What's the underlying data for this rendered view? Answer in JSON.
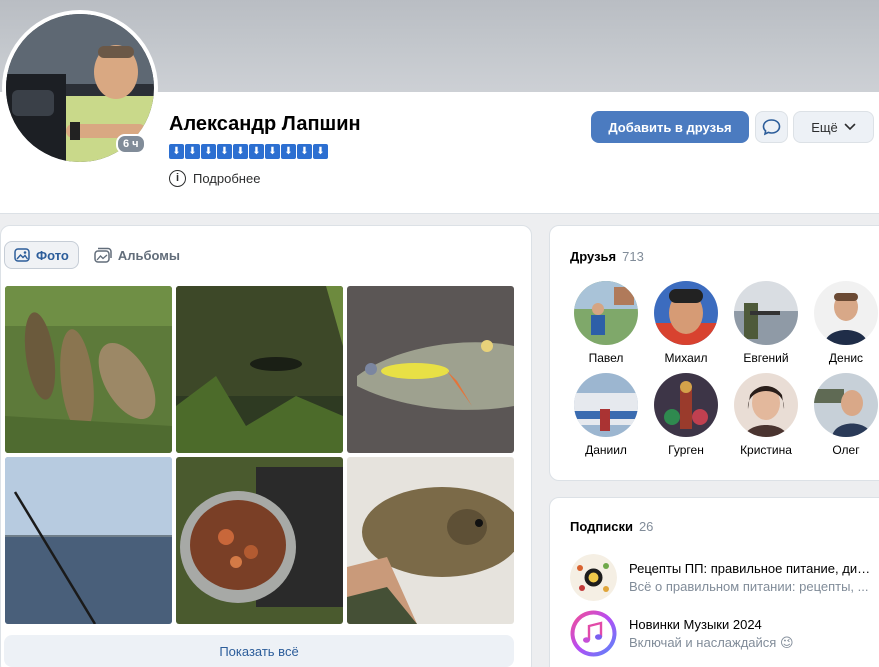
{
  "profile": {
    "name": "Александр Лапшин",
    "online_badge": "6 ч",
    "status_glyph": "⬇",
    "status_count": 10,
    "details_label": "Подробнее",
    "info_glyph": "i",
    "icons": {
      "info": "info-circle-icon",
      "message": "message-bubble-icon",
      "more": "chevron-down-icon"
    }
  },
  "actions": {
    "add_friend": "Добавить в друзья",
    "more": "Ещё"
  },
  "photos": {
    "tabs": [
      {
        "label": "Фото",
        "icon": "photo-icon",
        "active": true
      },
      {
        "label": "Альбомы",
        "icon": "albums-icon",
        "active": false
      }
    ],
    "show_all": "Показать всё"
  },
  "friends": {
    "title": "Друзья",
    "count": "713",
    "items": [
      {
        "name": "Павел"
      },
      {
        "name": "Михаил"
      },
      {
        "name": "Евгений"
      },
      {
        "name": "Денис"
      },
      {
        "name": "Даниил"
      },
      {
        "name": "Гурген"
      },
      {
        "name": "Кристина"
      },
      {
        "name": "Олег"
      }
    ]
  },
  "subscriptions": {
    "title": "Подписки",
    "count": "26",
    "items": [
      {
        "title": "Рецепты ПП: правильное питание, дие...",
        "desc": "Всё о правильном питании: рецепты, ..."
      },
      {
        "title": "Новинки Музыки 2024",
        "desc": "Включай и наслаждайся 😉"
      }
    ]
  },
  "colors": {
    "accent": "#4b7bc0",
    "link": "#2c5d9a",
    "muted": "#818c99"
  }
}
